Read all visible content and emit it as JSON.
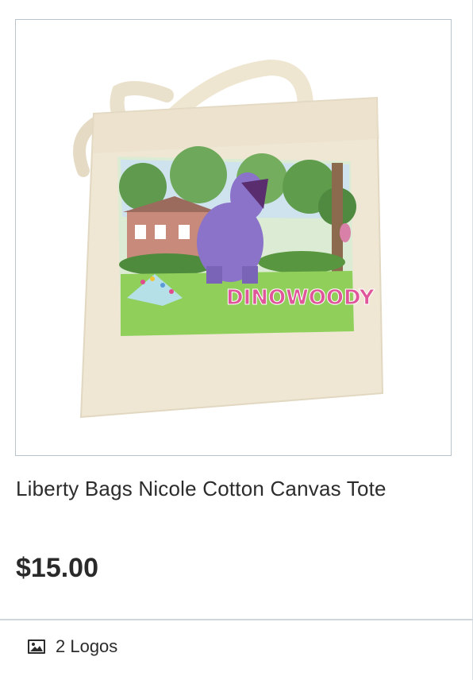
{
  "product": {
    "image_alt": "Liberty Bags Nicole Cotton Canvas Tote",
    "print_text": "DINOWOODY",
    "title": "Liberty Bags Nicole Cotton Canvas Tote",
    "price": "$15.00",
    "logos_label": "2 Logos",
    "logos_icon": "image-icon"
  }
}
